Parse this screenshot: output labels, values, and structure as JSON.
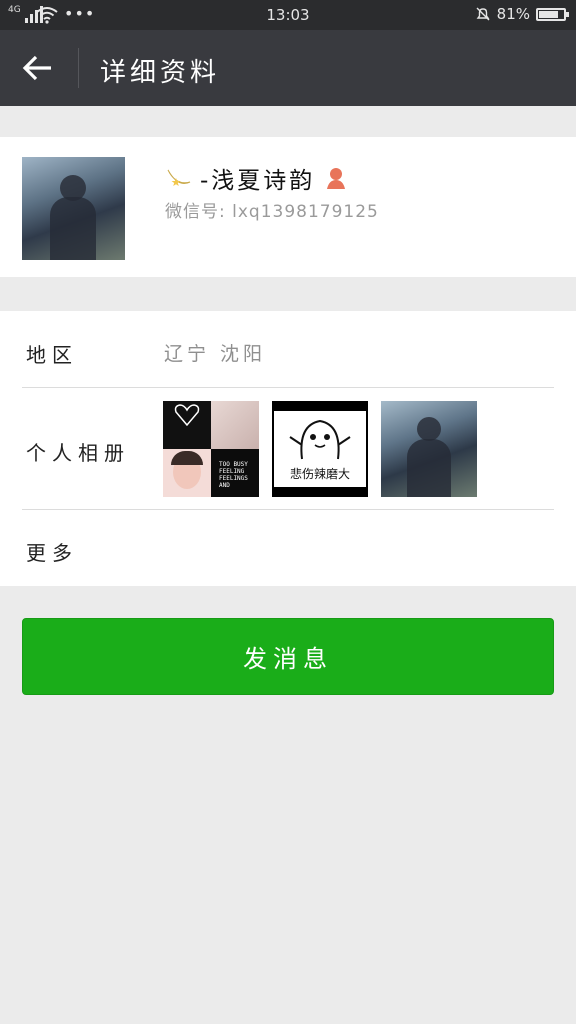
{
  "status_bar": {
    "network": "4G",
    "time": "13:03",
    "battery": "81%",
    "battery_level": 0.81
  },
  "navbar": {
    "title": "详细资料"
  },
  "profile": {
    "nickname": "-浅夏诗韵",
    "wechat_id": "微信号: lxq1398179125"
  },
  "info": {
    "region_label": "地区",
    "region_value": "辽宁  沈阳",
    "album_label": "个人相册",
    "more_label": "更多",
    "album_photos": [
      {
        "caption": "TOO BUSY FEELING FEELINGS AND"
      },
      {
        "caption": "悲伤辣磨大"
      },
      {
        "caption": ""
      }
    ]
  },
  "actions": {
    "send_label": "发消息"
  },
  "colors": {
    "status_bg": "#2b2c2e",
    "nav_bg": "#393a3f",
    "page_bg": "#ebebeb",
    "button_green": "#1aad19"
  }
}
